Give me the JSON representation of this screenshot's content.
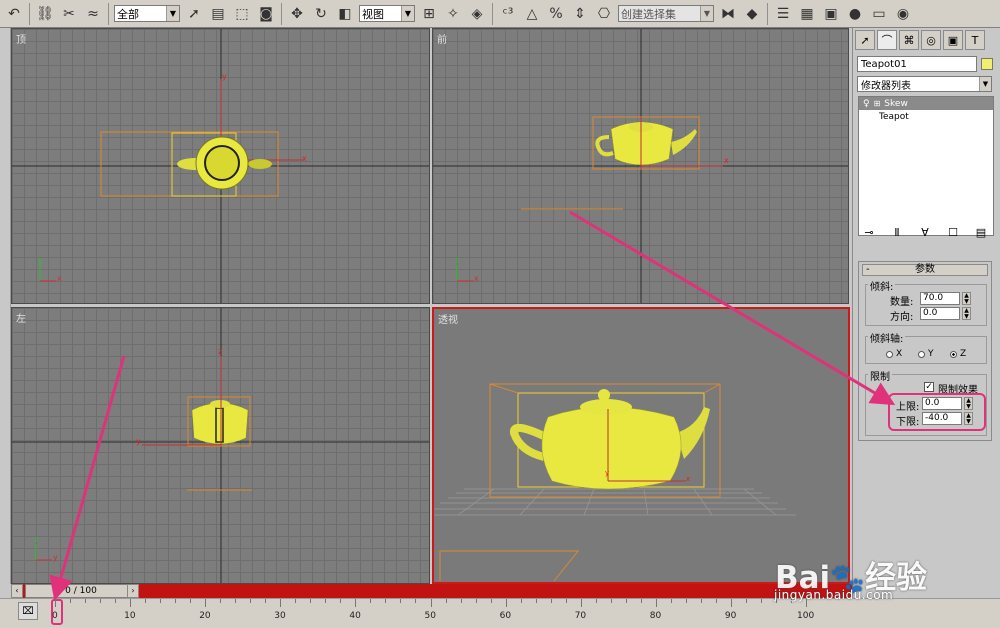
{
  "toolbar": {
    "selection_filter": "全部",
    "coordinate_system": "视图",
    "named_selection": "创建选择集",
    "icons": [
      "undo-icon",
      "link-icon",
      "unlink-icon",
      "bind-space-warp-icon",
      "select-arrow-icon",
      "select-by-name-icon",
      "rect-region-icon",
      "window-crossing-icon",
      "move-icon",
      "rotate-icon",
      "scale-icon",
      "manipulate-icon",
      "reference-icon",
      "snap-icon",
      "angle-snap-icon",
      "percent-snap-icon",
      "spinner-snap-icon",
      "edit-named-icon",
      "mirror-icon",
      "align-icon",
      "layer-icon",
      "curve-editor-icon",
      "schematic-icon",
      "material-editor-icon",
      "render-scene-icon",
      "quick-render-icon"
    ]
  },
  "viewports": {
    "top": {
      "label": "顶"
    },
    "front": {
      "label": "前"
    },
    "left": {
      "label": "左"
    },
    "perspective": {
      "label": "透视"
    }
  },
  "axis_letters": {
    "x": "x",
    "y": "y",
    "z": "z"
  },
  "panel": {
    "tabs": [
      "create-icon",
      "modify-icon",
      "hierarchy-icon",
      "motion-icon",
      "display-icon",
      "utilities-icon"
    ],
    "object_name": "Teapot01",
    "object_color": "#f0f06c",
    "modifier_list": "修改器列表",
    "stack": [
      "Skew",
      "Teapot"
    ],
    "rollout_title": "参数",
    "skew": {
      "title": "倾斜:",
      "amount_label": "数量:",
      "amount": "70.0",
      "direction_label": "方向:",
      "direction": "0.0"
    },
    "axis": {
      "title": "倾斜轴:",
      "options": [
        "X",
        "Y",
        "Z"
      ],
      "selected": "Z"
    },
    "limits": {
      "title": "限制",
      "effect_label": "限制效果",
      "effect_checked": true,
      "upper_label": "上限:",
      "upper": "0.0",
      "lower_label": "下限:",
      "lower": "-40.0"
    }
  },
  "timeslider": {
    "position_text": "0 / 100",
    "current_frame": 0,
    "total_frames": 100
  },
  "track": {
    "labels": [
      "0",
      "10",
      "20",
      "30",
      "40",
      "50",
      "60",
      "70",
      "80",
      "90",
      "100"
    ]
  },
  "watermark": {
    "brand": "Bai",
    "brand2": "经验",
    "url": "jingyan.baidu.com"
  }
}
